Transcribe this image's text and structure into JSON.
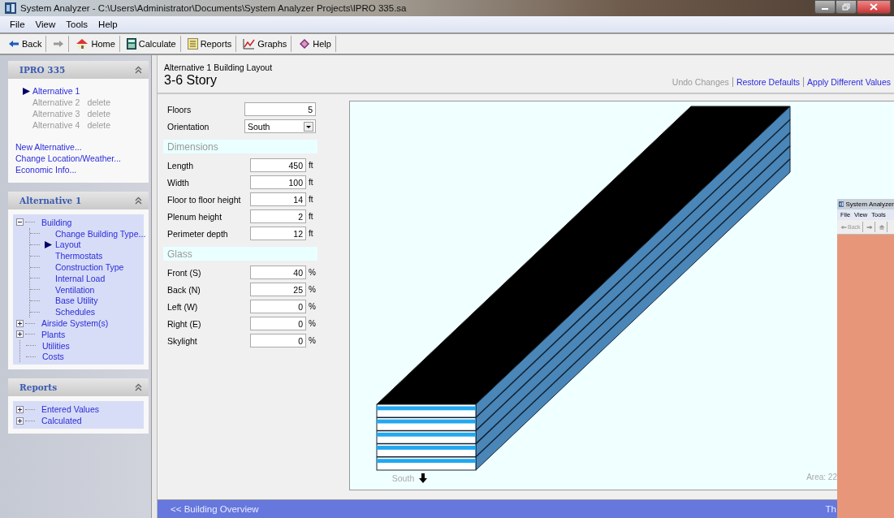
{
  "window": {
    "title": "System Analyzer - C:\\Users\\Administrator\\Documents\\System Analyzer Projects\\IPRO 335.sa"
  },
  "menu": [
    "File",
    "View",
    "Tools",
    "Help"
  ],
  "toolbar": [
    {
      "kind": "back",
      "label": "Back"
    },
    {
      "kind": "forward"
    },
    {
      "kind": "home",
      "label": "Home"
    },
    {
      "kind": "calculate",
      "label": "Calculate"
    },
    {
      "kind": "reports",
      "label": "Reports"
    },
    {
      "kind": "graphs",
      "label": "Graphs"
    },
    {
      "kind": "help",
      "label": "Help"
    }
  ],
  "sidebar": {
    "project": {
      "title": "IPRO 335",
      "alternatives": [
        {
          "label": "Alternative 1",
          "selected": true
        },
        {
          "label": "Alternative 2",
          "selected": false,
          "action": "delete"
        },
        {
          "label": "Alternative 3",
          "selected": false,
          "action": "delete"
        },
        {
          "label": "Alternative 4",
          "selected": false,
          "action": "delete"
        }
      ],
      "links": [
        "New Alternative...",
        "Change Location/Weather...",
        "Economic Info..."
      ]
    },
    "alternative": {
      "title": "Alternative 1",
      "tree": [
        {
          "label": "Building",
          "expanded": true,
          "children": [
            {
              "label": "Change Building Type...",
              "selected": false
            },
            {
              "label": "Layout",
              "selected": true
            },
            {
              "label": "Thermostats",
              "selected": false
            },
            {
              "label": "Construction Type",
              "selected": false
            },
            {
              "label": "Internal Load",
              "selected": false
            },
            {
              "label": "Ventilation",
              "selected": false
            },
            {
              "label": "Base Utility",
              "selected": false
            },
            {
              "label": "Schedules",
              "selected": false
            }
          ]
        },
        {
          "label": "Airside System(s)",
          "expanded": false
        },
        {
          "label": "Plants",
          "expanded": false
        },
        {
          "label": "Utilities"
        },
        {
          "label": "Costs"
        }
      ]
    },
    "reports": {
      "title": "Reports",
      "tree": [
        {
          "label": "Entered Values",
          "expanded": false
        },
        {
          "label": "Calculated",
          "expanded": false
        }
      ]
    }
  },
  "page": {
    "breadcrumb": "Alternative 1 Building Layout",
    "heading": "3-6 Story",
    "actions": [
      {
        "label": "Undo Changes",
        "disabled": true
      },
      {
        "label": "Restore Defaults",
        "disabled": false
      },
      {
        "label": "Apply Different Values",
        "disabled": false
      }
    ],
    "floors": {
      "label": "Floors",
      "value": "5"
    },
    "orientation": {
      "label": "Orientation",
      "value": "South"
    },
    "sections": [
      {
        "title": "Dimensions",
        "fields": [
          {
            "label": "Length",
            "value": "450",
            "unit": "ft"
          },
          {
            "label": "Width",
            "value": "100",
            "unit": "ft"
          },
          {
            "label": "Floor to floor height",
            "value": "14",
            "unit": "ft"
          },
          {
            "label": "Plenum height",
            "value": "2",
            "unit": "ft"
          },
          {
            "label": "Perimeter depth",
            "value": "12",
            "unit": "ft"
          }
        ]
      },
      {
        "title": "Glass",
        "fields": [
          {
            "label": "Front (S)",
            "value": "40",
            "unit": "%"
          },
          {
            "label": "Back (N)",
            "value": "25",
            "unit": "%"
          },
          {
            "label": "Left (W)",
            "value": "0",
            "unit": "%"
          },
          {
            "label": "Right (E)",
            "value": "0",
            "unit": "%"
          },
          {
            "label": "Skylight",
            "value": "0",
            "unit": "%"
          }
        ]
      }
    ],
    "view": {
      "direction": "South",
      "area": "Area: 22"
    },
    "footer": {
      "back_link": "<< Building Overview",
      "right_text": "Th"
    }
  },
  "second_window": {
    "title": "System Analyzer",
    "menu": [
      "File",
      "View",
      "Tools"
    ],
    "back": {
      "label": "Back",
      "disabled": true
    }
  }
}
